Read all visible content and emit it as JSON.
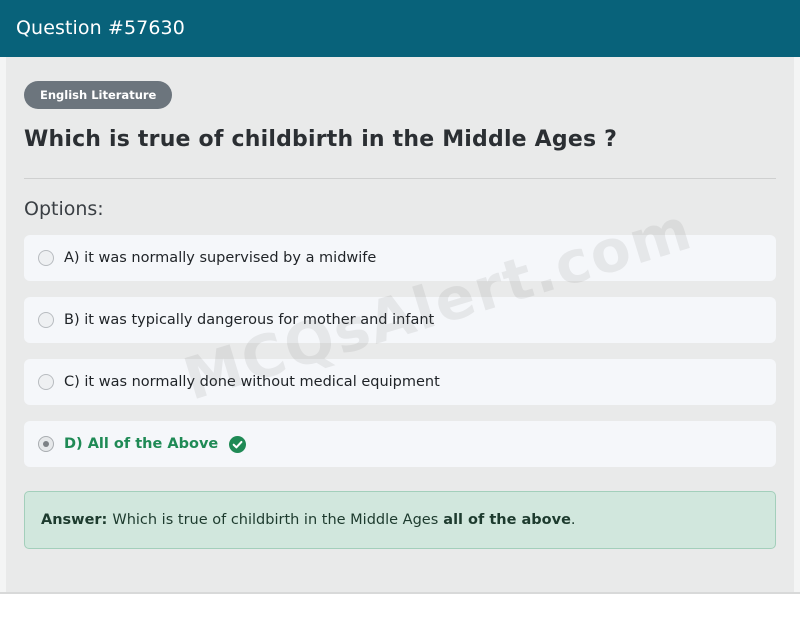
{
  "header": {
    "title": "Question #57630"
  },
  "category_badge": "English Literature",
  "question": "Which is true of childbirth in the Middle Ages ?",
  "options_heading": "Options:",
  "options": [
    {
      "label": "A) it was normally supervised by a midwife",
      "selected": false,
      "correct": false
    },
    {
      "label": "B) it was typically dangerous for mother and infant",
      "selected": false,
      "correct": false
    },
    {
      "label": "C) it was normally done without medical equipment",
      "selected": false,
      "correct": false
    },
    {
      "label": "D) All of the Above",
      "selected": true,
      "correct": true
    }
  ],
  "answer": {
    "label": "Answer:",
    "text": "Which is true of childbirth in the Middle Ages",
    "highlight": "all of the above",
    "end": "."
  },
  "watermark": "MCQsAlert.com",
  "colors": {
    "header_bg": "#08627a",
    "badge_bg": "#6c757d",
    "correct_text": "#1f8a55",
    "answer_bg": "#d1e7dd"
  },
  "icons": {
    "correct": "check-circle-icon"
  }
}
